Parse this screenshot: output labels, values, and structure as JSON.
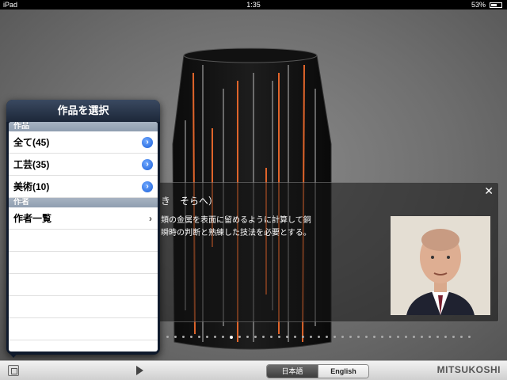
{
  "status": {
    "device": "iPad",
    "time": "1:35",
    "battery": "53%"
  },
  "info": {
    "title": "き　そらへ）",
    "description_line1": "類の金属を表面に留めるように計算して銅",
    "description_line2": "瞬時の判断と熟練した技法を必要とする。",
    "close_glyph": "✕"
  },
  "popover": {
    "title": "作品を選択",
    "section1": "作品",
    "items": [
      {
        "label": "全て(45)"
      },
      {
        "label": "工芸(35)"
      },
      {
        "label": "美術(10)"
      }
    ],
    "section2": "作者",
    "author_list": "作者一覧"
  },
  "toolbar": {
    "lang_ja": "日本語",
    "lang_en": "English",
    "brand": "MITSUKOSHI"
  },
  "colors": {
    "accent_orange": "#e0642a",
    "popover_bg": "#0f1a2c",
    "disclosure_blue": "#1b5fd8"
  }
}
